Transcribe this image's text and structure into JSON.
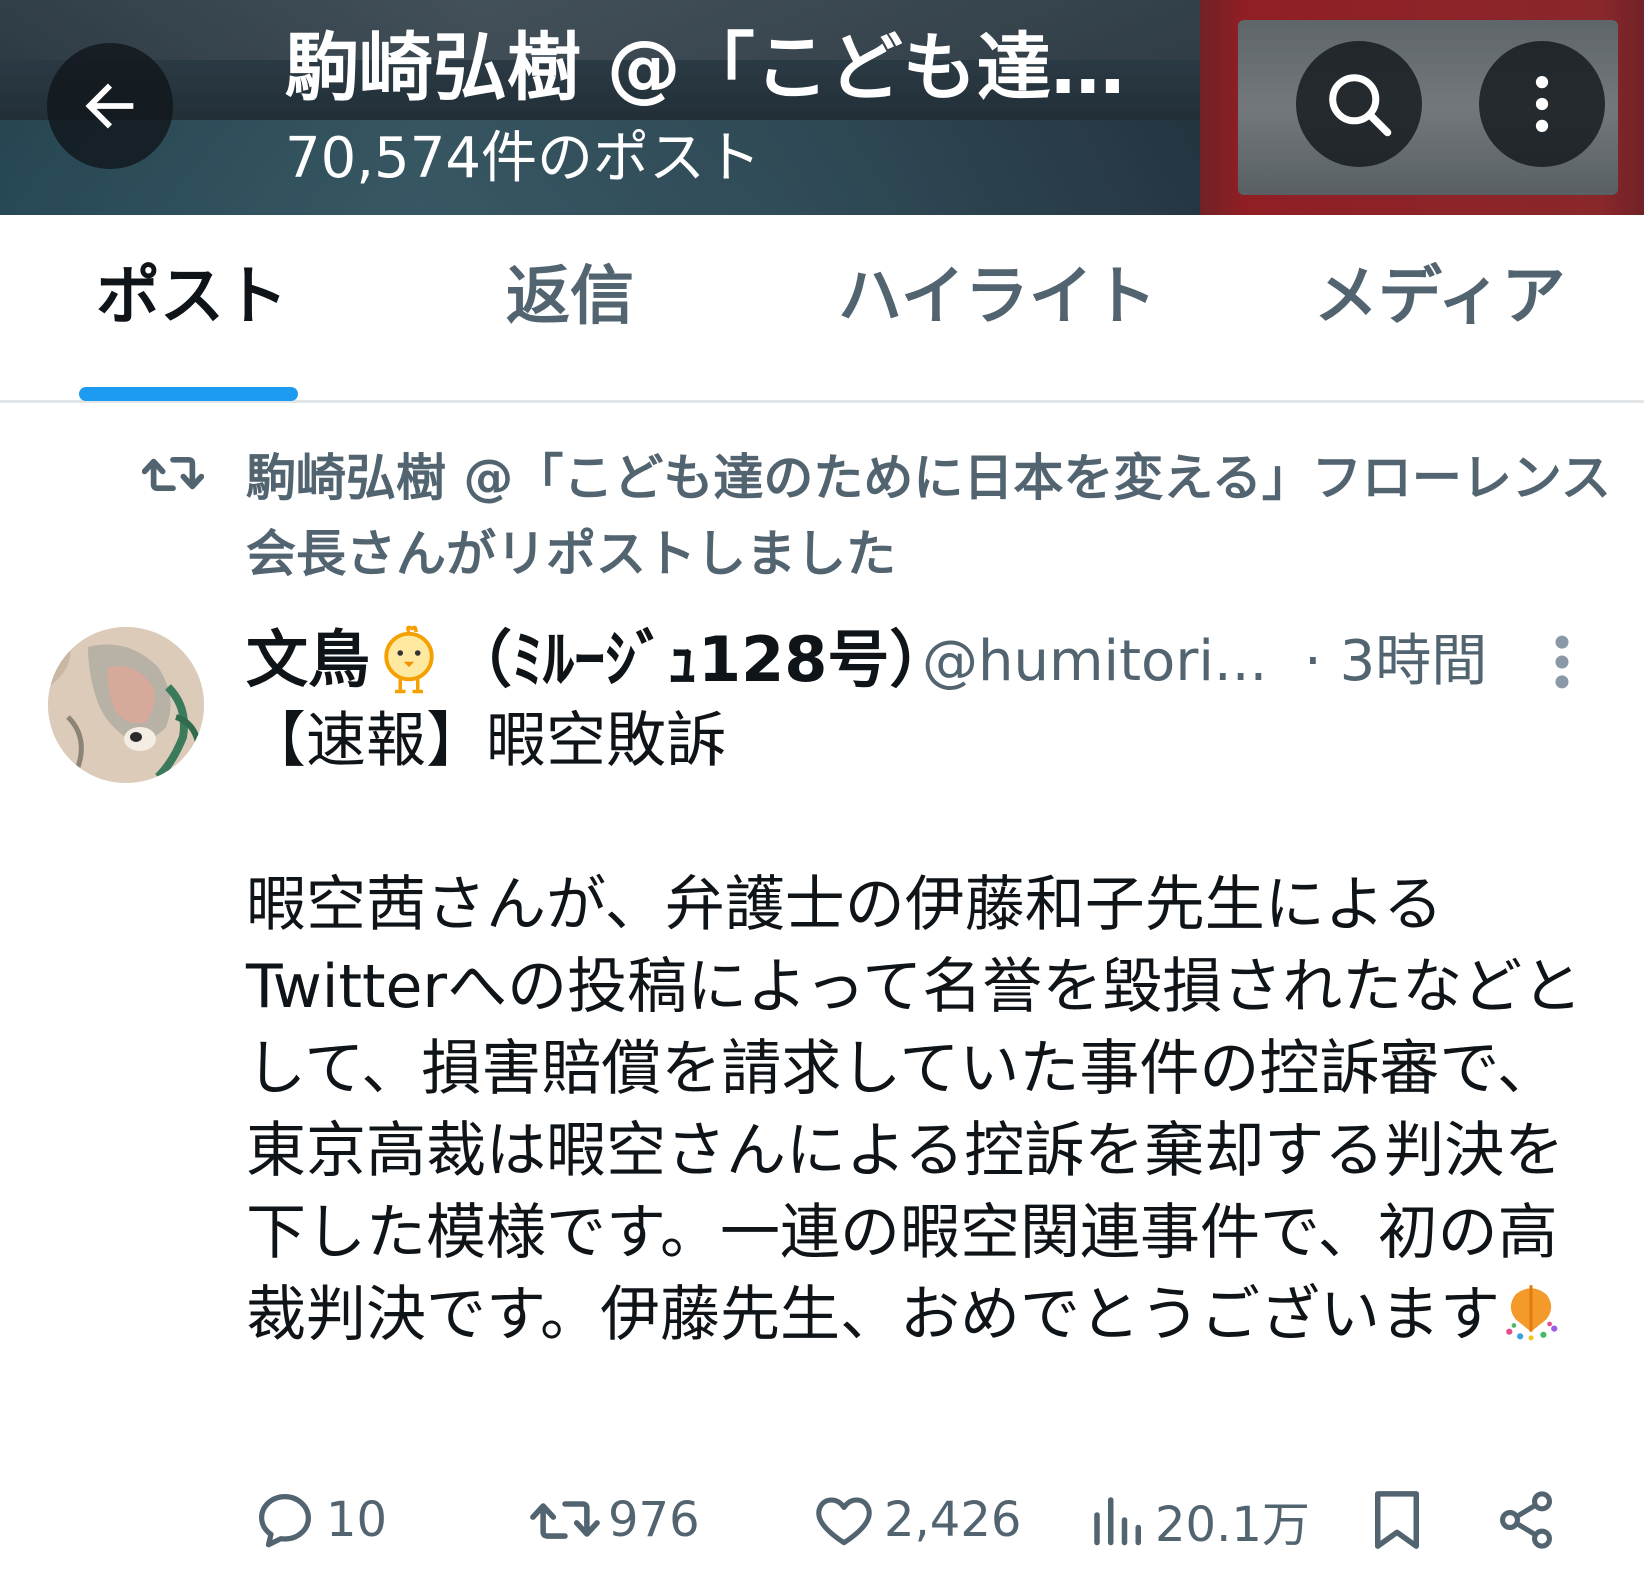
{
  "header": {
    "title": "駒崎弘樹 @「こども達のために日本を変える」フローレンス 会長",
    "post_count": "70,574件のポスト",
    "back_icon": "arrow-left-icon",
    "search_icon": "search-icon",
    "more_icon": "more-vertical-icon"
  },
  "tabs": [
    {
      "label": "ポスト",
      "active": true
    },
    {
      "label": "返信",
      "active": false
    },
    {
      "label": "ハイライト",
      "active": false
    },
    {
      "label": "メディア",
      "active": false
    }
  ],
  "repost_notice": "駒崎弘樹 @「こども達のために日本を変える」フローレンス 会長さんがリポストしました",
  "tweet": {
    "display_name_prefix": "文鳥",
    "display_name_suffix": "（ﾐﾙｰｼﾞｭ128号）",
    "handle": "@humitori...",
    "time": "· 3時間",
    "body_line1": "【速報】暇空敗訴",
    "body_main": "暇空茜さんが、弁護士の伊藤和子先生によるTwitterへの投稿によって名誉を毀損されたなどとして、損害賠償を請求していた事件の控訴審で、東京高裁は暇空さんによる控訴を棄却する判決を下した模様です。一連の暇空関連事件で、初の高裁判決です。伊藤先生、おめでとうございます",
    "emoji": "party-popper-icon"
  },
  "actions": {
    "replies": "10",
    "reposts": "976",
    "likes": "2,426",
    "views": "20.1万"
  },
  "colors": {
    "accent": "#1d9bf0",
    "text_primary": "#0f1419",
    "text_secondary": "#536471"
  }
}
